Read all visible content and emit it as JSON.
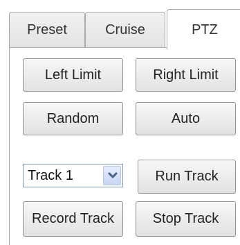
{
  "tabs": [
    {
      "label": "Preset",
      "active": false
    },
    {
      "label": "Cruise",
      "active": false
    },
    {
      "label": "PTZ",
      "active": true
    }
  ],
  "ptz": {
    "left_limit": "Left Limit",
    "right_limit": "Right Limit",
    "random": "Random",
    "auto": "Auto"
  },
  "track": {
    "select_value": "Track 1",
    "run": "Run Track",
    "record": "Record Track",
    "stop": "Stop Track"
  },
  "icons": {
    "dropdown": "chevron-down-icon"
  },
  "colors": {
    "select_border": "#7f9db9",
    "select_arrow": "#4d6185"
  }
}
